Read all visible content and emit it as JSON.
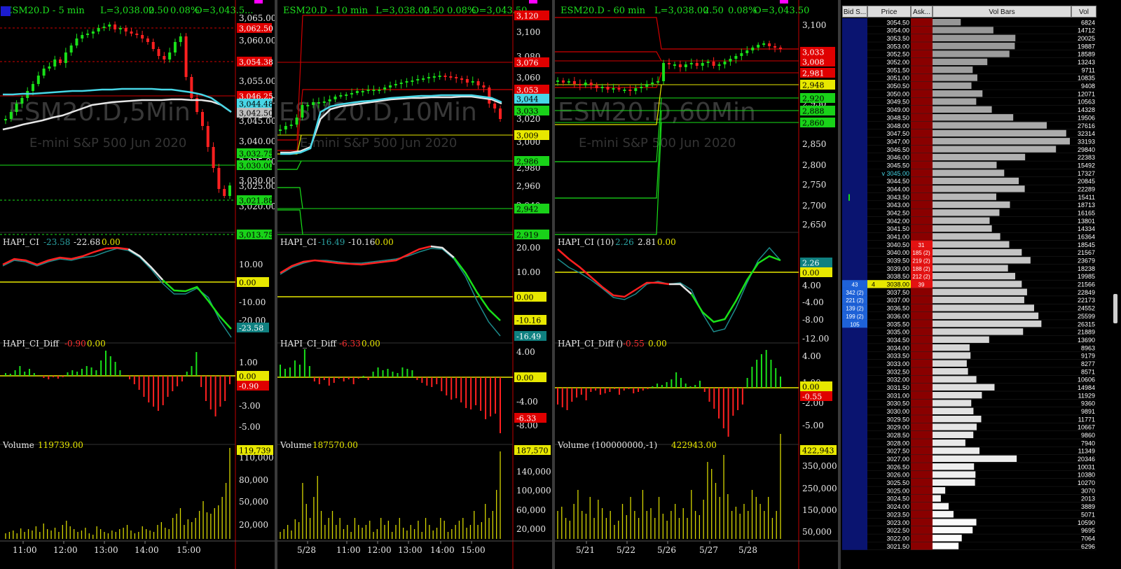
{
  "charts": [
    {
      "id": "c5",
      "header": {
        "symbol": "ESM20.D - 5 min",
        "last": "L=3,038.00",
        "chg": "2.50",
        "pct": "0.08%",
        "open": "O=3,043.5..."
      },
      "watermark": "ESM20.D,5Min",
      "description": "E-mini S&P 500 Jun 2020",
      "price_ticks": [
        "3,065.00",
        "3,060.00",
        "3,055.00",
        "3,050.00",
        "3,045.00",
        "3,040.00",
        "3,035.00",
        "3,030.00",
        "3,025.00",
        "3,020.00"
      ],
      "price_tags": [
        {
          "text": "3,062.50",
          "color": "#e00000"
        },
        {
          "text": "3,054.38",
          "color": "#e00000"
        },
        {
          "text": "3,046.25",
          "color": "#e00000"
        },
        {
          "text": "3,044.48",
          "color": "#47d6e6"
        },
        {
          "text": "3,042.50",
          "color": "#bdbdbd"
        },
        {
          "text": "3,032.75",
          "color": "#19d219"
        },
        {
          "text": "3,030.00",
          "color": "#19d219"
        },
        {
          "text": "3,021.88",
          "color": "#19d219"
        },
        {
          "text": "3,013.75",
          "color": "#19d219"
        }
      ],
      "ci": {
        "label": "HAPI_CI",
        "v1": "-23.58",
        "v2": "-22.68",
        "v3": "0.00",
        "ticks": [
          "10.00",
          "0.00",
          "-10.00",
          "-20.00"
        ],
        "tags": [
          {
            "text": "0.00",
            "color": "#e8e800"
          },
          {
            "text": "-23.58",
            "color": "#0f8080"
          }
        ]
      },
      "diff": {
        "label": "HAPI_CI_Diff",
        "v1": "-0.90",
        "v2": "0.00",
        "ticks": [
          "1.00",
          "-3.00",
          "-5.00"
        ],
        "tags": [
          {
            "text": "0.00",
            "color": "#e8e800"
          },
          {
            "text": "-0.90",
            "color": "#e00000"
          }
        ]
      },
      "volume": {
        "label": "Volume",
        "value": "119739.00",
        "ticks": [
          "110,000",
          "80,000",
          "50,000",
          "20,000"
        ],
        "tag": "119,739"
      },
      "time_ticks": [
        "11:00",
        "12:00",
        "13:00",
        "14:00",
        "15:00"
      ]
    },
    {
      "id": "c10",
      "header": {
        "symbol": "ESM20.D - 10 min",
        "last": "L=3,038.00",
        "chg": "2.50",
        "pct": "0.08%",
        "open": "O=3,043.50"
      },
      "watermark": "ESM20.D,10Min",
      "description": "E-mini S&P 500 Jun 2020",
      "price_ticks": [
        "3,100",
        "3,080",
        "3,060",
        "3,040",
        "3,020",
        "3,000",
        "2,980",
        "2,960",
        "2,940"
      ],
      "price_tags": [
        {
          "text": "3,120",
          "color": "#e00000"
        },
        {
          "text": "3,076",
          "color": "#e00000"
        },
        {
          "text": "3,053",
          "color": "#e00000"
        },
        {
          "text": "3,044",
          "color": "#47d6e6"
        },
        {
          "text": "3,033",
          "color": "#19d219"
        },
        {
          "text": "3,009",
          "color": "#e8e800"
        },
        {
          "text": "2,986",
          "color": "#19d219"
        },
        {
          "text": "2,942",
          "color": "#19d219"
        },
        {
          "text": "2,919",
          "color": "#19d219"
        }
      ],
      "ci": {
        "label": "HAPI_CI",
        "v1": "-16.49",
        "v2": "-10.16",
        "v3": "0.00",
        "ticks": [
          "20.00",
          "10.00"
        ],
        "tags": [
          {
            "text": "0.00",
            "color": "#e8e800"
          },
          {
            "text": "-10.16",
            "color": "#e8e800"
          },
          {
            "text": "-16.49",
            "color": "#0f8080"
          }
        ]
      },
      "diff": {
        "label": "HAPI_CI_Diff",
        "v1": "-6.33",
        "v2": "0.00",
        "ticks": [
          "4.00",
          "-4.00",
          "-8.00"
        ],
        "tags": [
          {
            "text": "0.00",
            "color": "#e8e800"
          },
          {
            "text": "-6.33",
            "color": "#e00000"
          }
        ]
      },
      "volume": {
        "label": "Volume",
        "value": "187570.00",
        "ticks": [
          "140,000",
          "100,000",
          "60,000",
          "20,000"
        ],
        "tag": "187,570"
      },
      "time_ticks": [
        "5/28",
        "11:00",
        "12:00",
        "13:00",
        "14:00",
        "15:00"
      ]
    },
    {
      "id": "c60",
      "header": {
        "symbol": "ESM20.D - 60 min",
        "last": "L=3,038.00",
        "chg": "2.50",
        "pct": "0.08%",
        "open": "O=3,043.50"
      },
      "watermark": "ESM20.D,60Min",
      "description": "E-mini S&P 500 Jun 2020",
      "price_ticks": [
        "3,100",
        "3,050",
        "2,950",
        "2,900",
        "2,850",
        "2,800",
        "2,750",
        "2,700",
        "2,650"
      ],
      "price_tags": [
        {
          "text": "3,033",
          "color": "#e00000"
        },
        {
          "text": "3,008",
          "color": "#e00000"
        },
        {
          "text": "2,981",
          "color": "#e00000"
        },
        {
          "text": "2,948",
          "color": "#e8e800"
        },
        {
          "text": "2,920",
          "color": "#19d219"
        },
        {
          "text": "2,888",
          "color": "#19d219"
        },
        {
          "text": "2,860",
          "color": "#19d219"
        }
      ],
      "ci": {
        "label": "HAPI_CI (10)",
        "v1": "2.26",
        "v2": "2.81",
        "v3": "0.00",
        "ticks": [
          "4.00",
          "-4.00",
          "-8.00",
          "-12.00"
        ],
        "tags": [
          {
            "text": "2.26",
            "color": "#0f8080"
          },
          {
            "text": "0.00",
            "color": "#e8e800"
          }
        ]
      },
      "diff": {
        "label": "HAPI_CI_Diff ()",
        "v1": "-0.55",
        "v2": "0.00",
        "ticks": [
          "4.00",
          "1.00",
          "-2.00",
          "-5.00"
        ],
        "tags": [
          {
            "text": "0.00",
            "color": "#e8e800"
          },
          {
            "text": "-0.55",
            "color": "#e00000"
          }
        ]
      },
      "volume": {
        "label": "Volume (100000000,-1)",
        "value": "422943.00",
        "ticks": [
          "350,000",
          "250,000",
          "150,000",
          "50,000"
        ],
        "tag": "422,943"
      },
      "time_ticks": [
        "5/21",
        "5/22",
        "5/26",
        "5/27",
        "5/28"
      ]
    }
  ],
  "dom": {
    "headers": {
      "bid": "Bid S...",
      "price": "Price",
      "ask": "Ask...",
      "bars": "Vol Bars",
      "vol": "Vol"
    },
    "current_marker": "v 3045.00",
    "rows": [
      {
        "price": "3054.50",
        "vol": "6824"
      },
      {
        "price": "3054.00",
        "vol": "14712"
      },
      {
        "price": "3053.50",
        "vol": "20025"
      },
      {
        "price": "3053.00",
        "vol": "19887"
      },
      {
        "price": "3052.50",
        "vol": "18589"
      },
      {
        "price": "3052.00",
        "vol": "13243"
      },
      {
        "price": "3051.50",
        "vol": "9711"
      },
      {
        "price": "3051.00",
        "vol": "10835"
      },
      {
        "price": "3050.50",
        "vol": "9408"
      },
      {
        "price": "3050.00",
        "vol": "12071"
      },
      {
        "price": "3049.50",
        "vol": "10563"
      },
      {
        "price": "3049.00",
        "vol": "14328"
      },
      {
        "price": "3048.50",
        "vol": "19506"
      },
      {
        "price": "3048.00",
        "vol": "27616"
      },
      {
        "price": "3047.50",
        "vol": "32314"
      },
      {
        "price": "3047.00",
        "vol": "33193"
      },
      {
        "price": "3046.50",
        "vol": "29840"
      },
      {
        "price": "3046.00",
        "vol": "22383"
      },
      {
        "price": "3045.50",
        "vol": "15492"
      },
      {
        "price": "3045.00",
        "vol": "17327"
      },
      {
        "price": "3044.50",
        "vol": "20845"
      },
      {
        "price": "3044.00",
        "vol": "22289"
      },
      {
        "price": "3043.50",
        "vol": "15411"
      },
      {
        "price": "3043.00",
        "vol": "18713"
      },
      {
        "price": "3042.50",
        "vol": "16165"
      },
      {
        "price": "3042.00",
        "vol": "13801"
      },
      {
        "price": "3041.50",
        "vol": "14334"
      },
      {
        "price": "3041.00",
        "vol": "16364"
      },
      {
        "price": "3040.50",
        "vol": "18545",
        "ask": "31"
      },
      {
        "price": "3040.00",
        "vol": "21567",
        "ask": "185 (2)"
      },
      {
        "price": "3039.50",
        "vol": "23679",
        "ask": "219 (2)"
      },
      {
        "price": "3039.00",
        "vol": "18238",
        "ask": "188 (2)"
      },
      {
        "price": "3038.50",
        "vol": "19985",
        "ask": "212 (2)"
      },
      {
        "price": "3038.00",
        "vol": "21566",
        "bid": "43",
        "ask": "39",
        "last": "4"
      },
      {
        "price": "3037.50",
        "vol": "22849",
        "bid": "342 (2)"
      },
      {
        "price": "3037.00",
        "vol": "22173",
        "bid": "221 (2)"
      },
      {
        "price": "3036.50",
        "vol": "24552",
        "bid": "139 (2)"
      },
      {
        "price": "3036.00",
        "vol": "25599",
        "bid": "199 (2)"
      },
      {
        "price": "3035.50",
        "vol": "26315",
        "bid": "105"
      },
      {
        "price": "3035.00",
        "vol": "21889"
      },
      {
        "price": "3034.50",
        "vol": "13690"
      },
      {
        "price": "3034.00",
        "vol": "8963"
      },
      {
        "price": "3033.50",
        "vol": "9179"
      },
      {
        "price": "3033.00",
        "vol": "8277"
      },
      {
        "price": "3032.50",
        "vol": "8571"
      },
      {
        "price": "3032.00",
        "vol": "10606"
      },
      {
        "price": "3031.50",
        "vol": "14984"
      },
      {
        "price": "3031.00",
        "vol": "11929"
      },
      {
        "price": "3030.50",
        "vol": "9360"
      },
      {
        "price": "3030.00",
        "vol": "9891"
      },
      {
        "price": "3029.50",
        "vol": "11771"
      },
      {
        "price": "3029.00",
        "vol": "10667"
      },
      {
        "price": "3028.50",
        "vol": "9860"
      },
      {
        "price": "3028.00",
        "vol": "7940"
      },
      {
        "price": "3027.50",
        "vol": "11349"
      },
      {
        "price": "3027.00",
        "vol": "20346"
      },
      {
        "price": "3026.50",
        "vol": "10031"
      },
      {
        "price": "3026.00",
        "vol": "10380"
      },
      {
        "price": "3025.50",
        "vol": "10270"
      },
      {
        "price": "3025.00",
        "vol": "3070"
      },
      {
        "price": "3024.50",
        "vol": "2013"
      },
      {
        "price": "3024.00",
        "vol": "3889"
      },
      {
        "price": "3023.50",
        "vol": "5071"
      },
      {
        "price": "3023.00",
        "vol": "10590"
      },
      {
        "price": "3022.50",
        "vol": "9695"
      },
      {
        "price": "3022.00",
        "vol": "7064"
      },
      {
        "price": "3021.50",
        "vol": "6296"
      }
    ]
  },
  "colors": {
    "up": "#19e019",
    "down": "#ff2020",
    "yellow": "#e8e800",
    "cyan": "#47d6e6",
    "white": "#e6e6e6",
    "axis_red": "#c00000",
    "grid_red": "#d00000",
    "bid_bg": "#0a1470",
    "ask_bg": "#8a0000"
  }
}
